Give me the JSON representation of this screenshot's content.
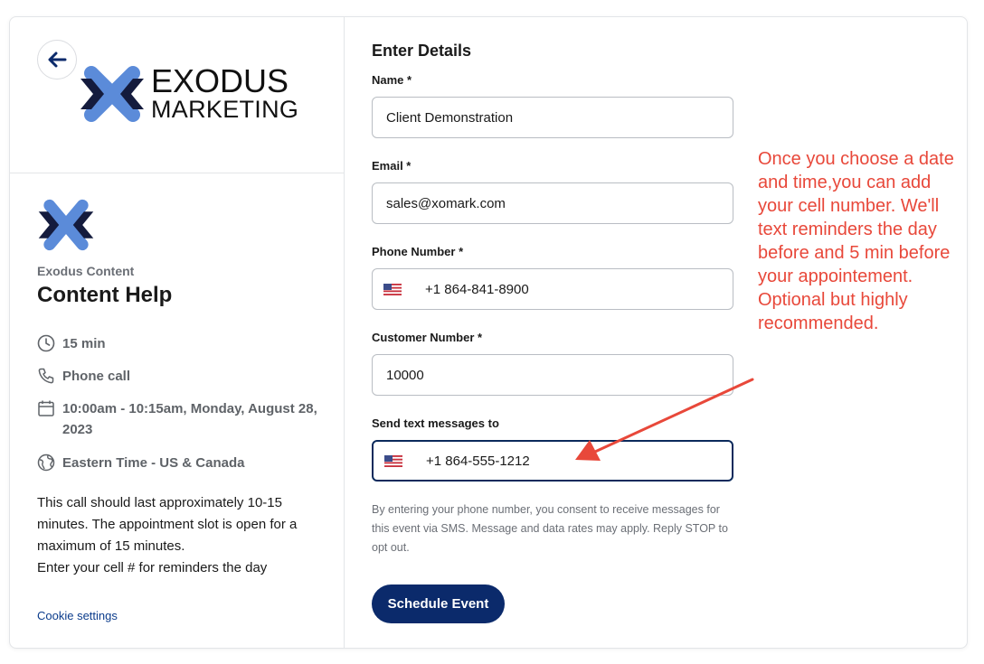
{
  "brand": {
    "logo_line1": "EXODUS",
    "logo_line2": "MARKETING",
    "accent_blue": "#5b8bd9",
    "dark_navy": "#141b3d"
  },
  "event": {
    "org_name": "Exodus Content",
    "title": "Content Help",
    "duration": "15 min",
    "location": "Phone call",
    "datetime": "10:00am - 10:15am, Monday, August 28, 2023",
    "timezone": "Eastern Time - US & Canada",
    "description": [
      "This call should last approximately 10-15 minutes. The appointment slot is open for a maximum of 15 minutes.",
      "Enter your cell # for reminders the day"
    ],
    "cookie_settings": "Cookie settings"
  },
  "form": {
    "title": "Enter Details",
    "name_label": "Name *",
    "name_value": "Client Demonstration",
    "email_label": "Email *",
    "email_value": "sales@xomark.com",
    "phone_label": "Phone Number *",
    "phone_value": "+1 864-841-8900",
    "customer_label": "Customer Number *",
    "customer_value": "10000",
    "sms_label": "Send text messages to",
    "sms_value": "+1 864-555-1212",
    "consent": "By entering your phone number, you consent to receive messages for this event via SMS. Message and data rates may apply. Reply STOP to opt out.",
    "submit": "Schedule Event",
    "button_color": "#0b2a6b"
  },
  "annotation": {
    "text": "Once you choose a date and time,you can add your cell number. We'll text reminders the day before and 5 min before your appointement. Optional but highly recommended.",
    "color": "#e8483a"
  }
}
